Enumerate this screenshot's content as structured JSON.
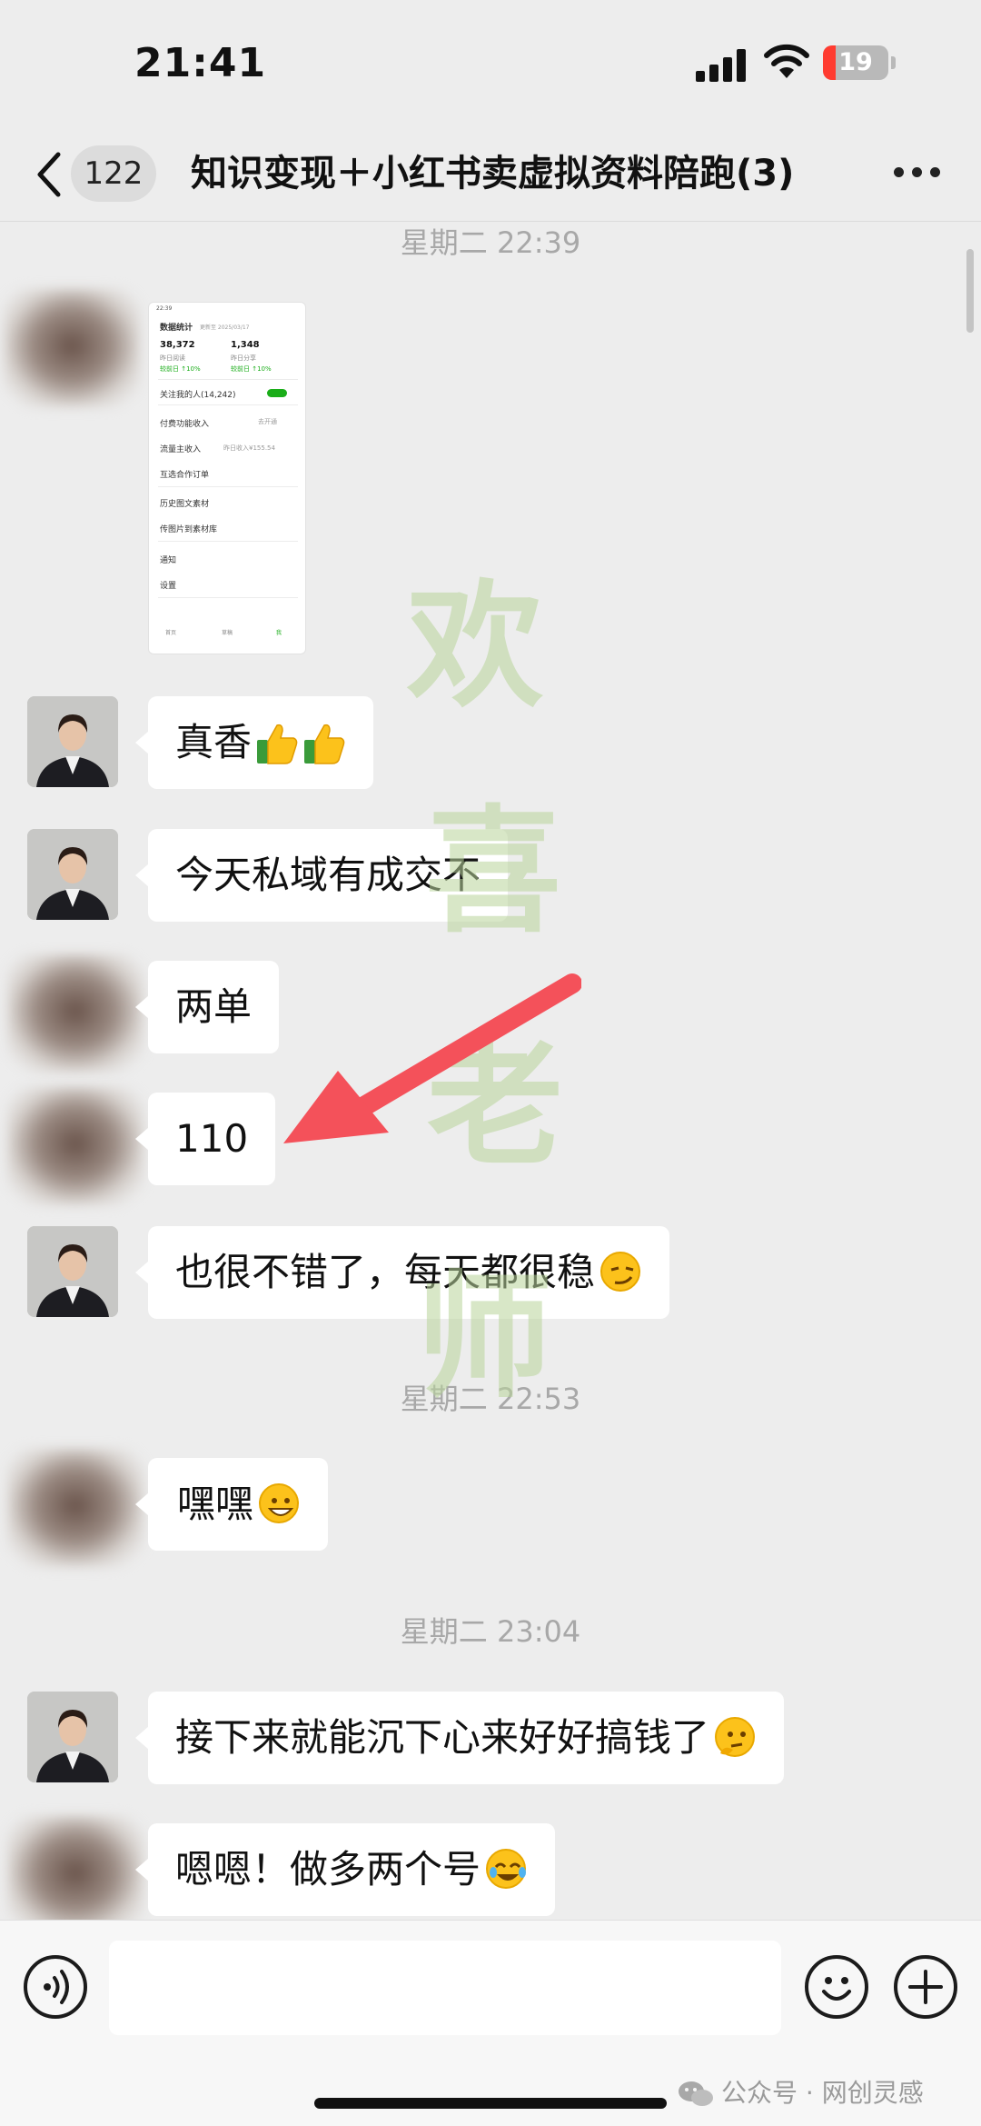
{
  "status_bar": {
    "time": "21:41",
    "battery_level": "19",
    "battery_fraction": 0.19
  },
  "nav": {
    "unread_count": "122",
    "title": "知识变现＋小红书卖虚拟资料陪跑(3)"
  },
  "timestamps": [
    "星期二 22:39",
    "星期二 22:53",
    "星期二 23:04"
  ],
  "image_thumbnail": {
    "header": "数据统计",
    "header_date": "更新至 2025/03/17",
    "stat1_value": "38,372",
    "stat1_label": "昨日阅读",
    "stat1_delta": "较前日 ↑10%",
    "stat2_value": "1,348",
    "stat2_label": "昨日分享",
    "stat2_delta": "较前日 ↑10%",
    "rows": [
      "关注我的人(14,242)",
      "付费功能收入",
      "流量主收入",
      "互选合作订单",
      "历史图文素材",
      "传图片到素材库",
      "通知",
      "设置"
    ],
    "row_right_2": "去开通",
    "row_right_3": "昨日收入¥155.54",
    "tabs": [
      "首页",
      "草稿",
      "我"
    ]
  },
  "messages": [
    {
      "sender": "teacher",
      "text": "真香",
      "emoji": [
        "thumbs-up-icon",
        "thumbs-up-icon"
      ]
    },
    {
      "sender": "teacher",
      "text": "今天私域有成交不"
    },
    {
      "sender": "student",
      "text": "两单"
    },
    {
      "sender": "student",
      "text": "110"
    },
    {
      "sender": "teacher",
      "text": "也很不错了，每天都很稳",
      "emoji": [
        "smirk-face-icon"
      ]
    },
    {
      "sender": "student",
      "text": "嘿嘿",
      "emoji": [
        "grin-face-icon"
      ]
    },
    {
      "sender": "teacher",
      "text": "接下来就能沉下心来好好搞钱了",
      "emoji": [
        "thinking-face-icon"
      ]
    },
    {
      "sender": "student",
      "text": "嗯嗯！做多两个号",
      "emoji": [
        "laugh-cry-face-icon"
      ]
    }
  ],
  "watermark": [
    "欢",
    "喜",
    "老",
    "师"
  ],
  "footer": {
    "source": "公众号 · 网创灵感"
  },
  "colors": {
    "background": "#ededed",
    "bubble": "#ffffff",
    "arrow": "#f4515a",
    "watermark": "#b9d59b",
    "battery_low": "#ff3b30"
  }
}
